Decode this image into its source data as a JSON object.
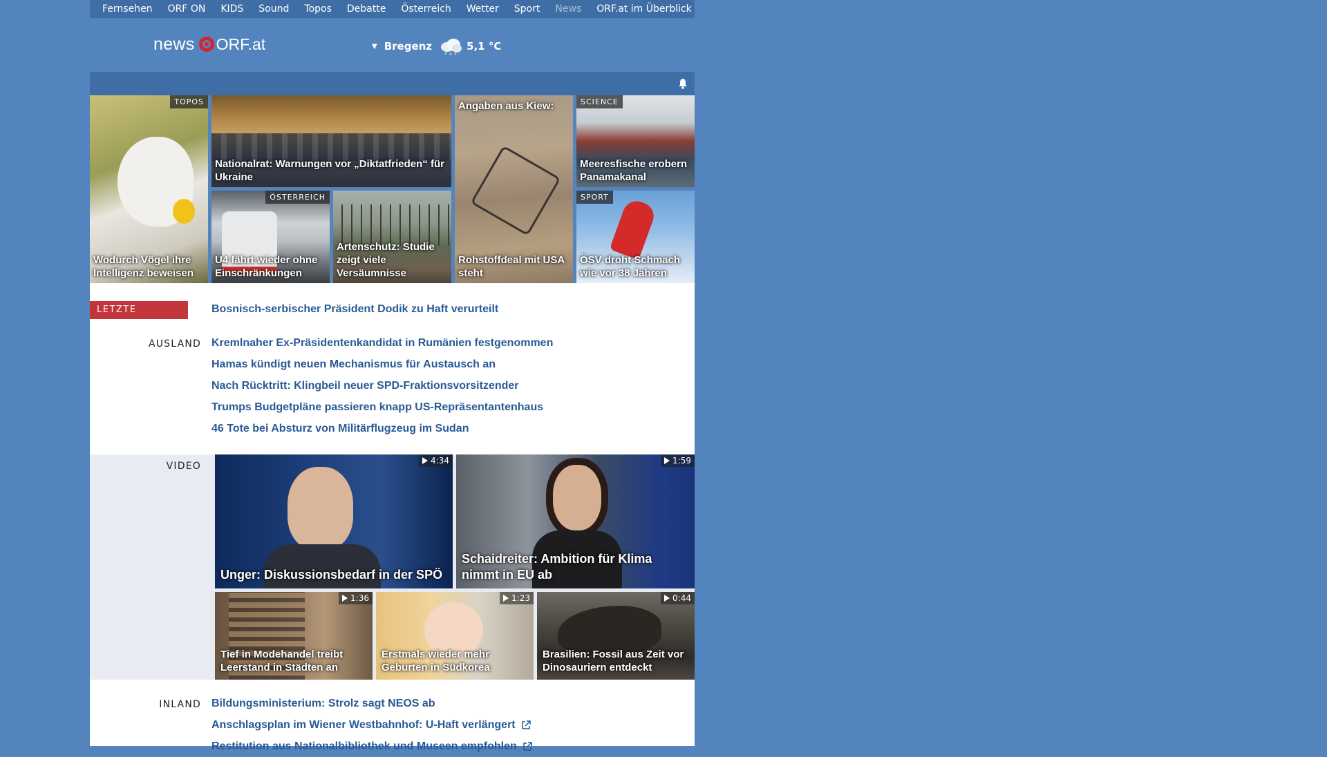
{
  "nav": {
    "items": [
      "Fernsehen",
      "ORF ON",
      "KIDS",
      "Sound",
      "Topos",
      "Debatte",
      "Österreich",
      "Wetter",
      "Sport",
      "News"
    ],
    "overview": "ORF.at im Überblick"
  },
  "logo": {
    "news": "news",
    "orf": "ORF.at"
  },
  "weather": {
    "location": "Bregenz",
    "temperature": "5,1 °C",
    "icon": "cloud-rain-icon"
  },
  "colors": {
    "page_bg": "#5484be",
    "nav_bg": "#3f6ea6",
    "link": "#2a5a96",
    "breaking": "#c2353b",
    "orf_red": "#d8232a"
  },
  "tiles": [
    {
      "title": "Wodurch Vögel ihre Intelligenz beweisen",
      "tag": "TOPOS"
    },
    {
      "title": "Nationalrat: Warnungen vor „Diktatfrieden“ für Ukraine",
      "tag": ""
    },
    {
      "title": "Angaben aus Kiew:",
      "tag": ""
    },
    {
      "title": "Rohstoffdeal mit USA steht",
      "tag": ""
    },
    {
      "title": "Meeresfische erobern Panamakanal",
      "tag": "SCIENCE"
    },
    {
      "title": "U4 fährt wieder ohne Einschränkungen",
      "tag": "ÖSTERREICH"
    },
    {
      "title": "Artenschutz: Studie zeigt viele Versäumnisse",
      "tag": ""
    },
    {
      "title": "ÖSV droht Schmach wie vor 38 Jahren",
      "tag": "SPORT"
    }
  ],
  "breaking": {
    "label": "LETZTE MELDUNG",
    "headline": "Bosnisch-serbischer Präsident Dodik zu Haft verurteilt"
  },
  "ausland": {
    "label": "AUSLAND",
    "items": [
      "Kremlnaher Ex-Präsidentenkandidat in Rumänien festgenommen",
      "Hamas kündigt neuen Mechanismus für Austausch an",
      "Nach Rücktritt: Klingbeil neuer SPD-Fraktionsvorsitzender",
      "Trumps Budgetpläne passieren knapp US-Repräsentantenhaus",
      "46 Tote bei Absturz von Militärflugzeug im Sudan"
    ]
  },
  "video": {
    "label": "VIDEO",
    "items": [
      {
        "title": "Unger: Diskussionsbedarf in der SPÖ",
        "duration": "4:34"
      },
      {
        "title": "Schaidreiter: Ambition für Klima nimmt in EU ab",
        "duration": "1:59"
      },
      {
        "title": "Tief in Modehandel treibt Leerstand in Städten an",
        "duration": "1:36"
      },
      {
        "title": "Erstmals wieder mehr Geburten in Südkorea",
        "duration": "1:23"
      },
      {
        "title": "Brasilien: Fossil aus Zeit vor Dinosauriern entdeckt",
        "duration": "0:44"
      }
    ]
  },
  "inland": {
    "label": "INLAND",
    "items": [
      "Bildungsministerium: Strolz sagt NEOS ab",
      "Anschlagsplan im Wiener Westbahnhof: U-Haft verlängert",
      "Restitution aus Nationalbibliothek und Museen empfohlen"
    ]
  }
}
